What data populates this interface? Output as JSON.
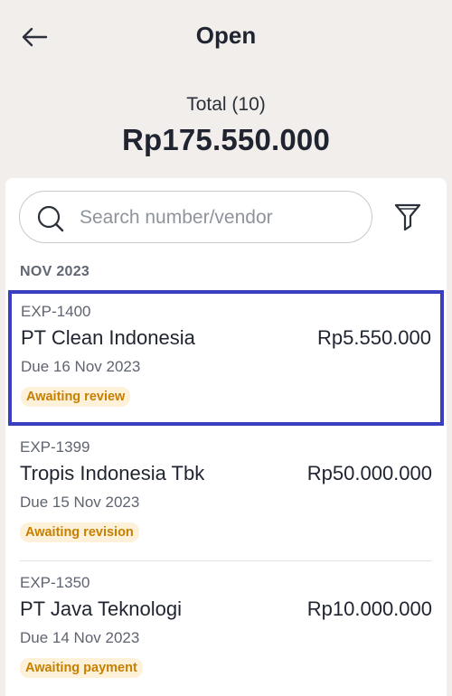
{
  "header": {
    "title": "Open"
  },
  "summary": {
    "label": "Total (10)",
    "amount": "Rp175.550.000"
  },
  "search": {
    "placeholder": "Search number/vendor",
    "value": ""
  },
  "section": {
    "label": "NOV 2023"
  },
  "items": [
    {
      "number": "EXP-1400",
      "vendor": "PT Clean Indonesia",
      "amount": "Rp5.550.000",
      "due": "Due 16 Nov 2023",
      "status": "Awaiting review",
      "selected": true
    },
    {
      "number": "EXP-1399",
      "vendor": "Tropis Indonesia Tbk",
      "amount": "Rp50.000.000",
      "due": "Due 15 Nov 2023",
      "status": "Awaiting revision",
      "selected": false
    },
    {
      "number": "EXP-1350",
      "vendor": "PT Java Teknologi",
      "amount": "Rp10.000.000",
      "due": "Due 14 Nov 2023",
      "status": "Awaiting payment",
      "selected": false
    }
  ],
  "colors": {
    "selection": "#3a3fc2",
    "badge_text": "#c77f00",
    "badge_bg": "#fdf1d9",
    "background": "#f1eeeb"
  },
  "icons": {
    "back": "arrow-left-icon",
    "search": "search-icon",
    "filter": "filter-icon"
  }
}
